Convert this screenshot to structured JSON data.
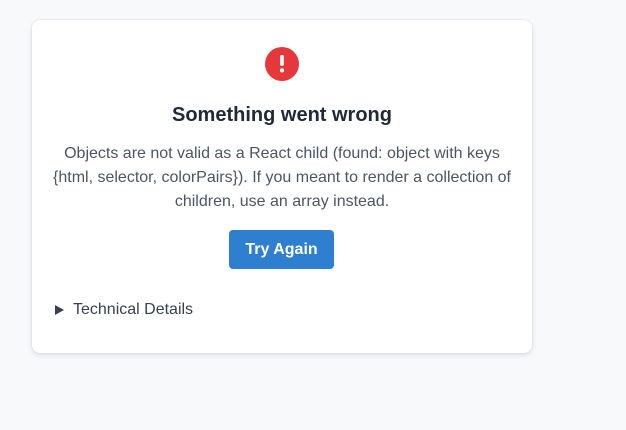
{
  "error_card": {
    "icon": "exclamation-circle-icon",
    "icon_color": "#e5383b",
    "title": "Something went wrong",
    "message": "Objects are not valid as a React child (found: object with keys {html, selector, colorPairs}). If you meant to render a collection of children, use an array instead.",
    "retry_button_label": "Try Again",
    "retry_button_color": "#2f7fd0",
    "details_toggle_label": "Technical Details",
    "details_icon": "disclosure-triangle-right-icon"
  }
}
